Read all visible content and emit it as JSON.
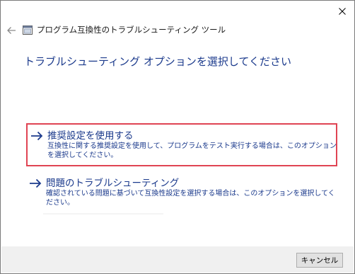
{
  "window": {
    "title": "プログラム互換性のトラブルシューティング ツール",
    "close_icon": "close-icon",
    "back_icon": "back-arrow-icon",
    "app_icon": "program-compatibility-icon"
  },
  "main": {
    "heading": "トラブルシューティング オプションを選択してください",
    "options": [
      {
        "title": "推奨設定を使用する",
        "description": "互換性に関する推奨設定を使用して、プログラムをテスト実行する場合は、このオプションを選択してください。",
        "icon": "arrow-right-icon",
        "selected": true
      },
      {
        "title": "問題のトラブルシューティング",
        "description": "確認されている問題に基づいて互換性設定を選択する場合は、このオプションを選択してください。",
        "icon": "arrow-right-icon",
        "selected": false
      }
    ]
  },
  "footer": {
    "cancel_label": "キャンセル"
  },
  "colors": {
    "link_blue": "#1b3a8c",
    "selection_border": "#e04453",
    "footer_bg": "#f0f0f0"
  }
}
